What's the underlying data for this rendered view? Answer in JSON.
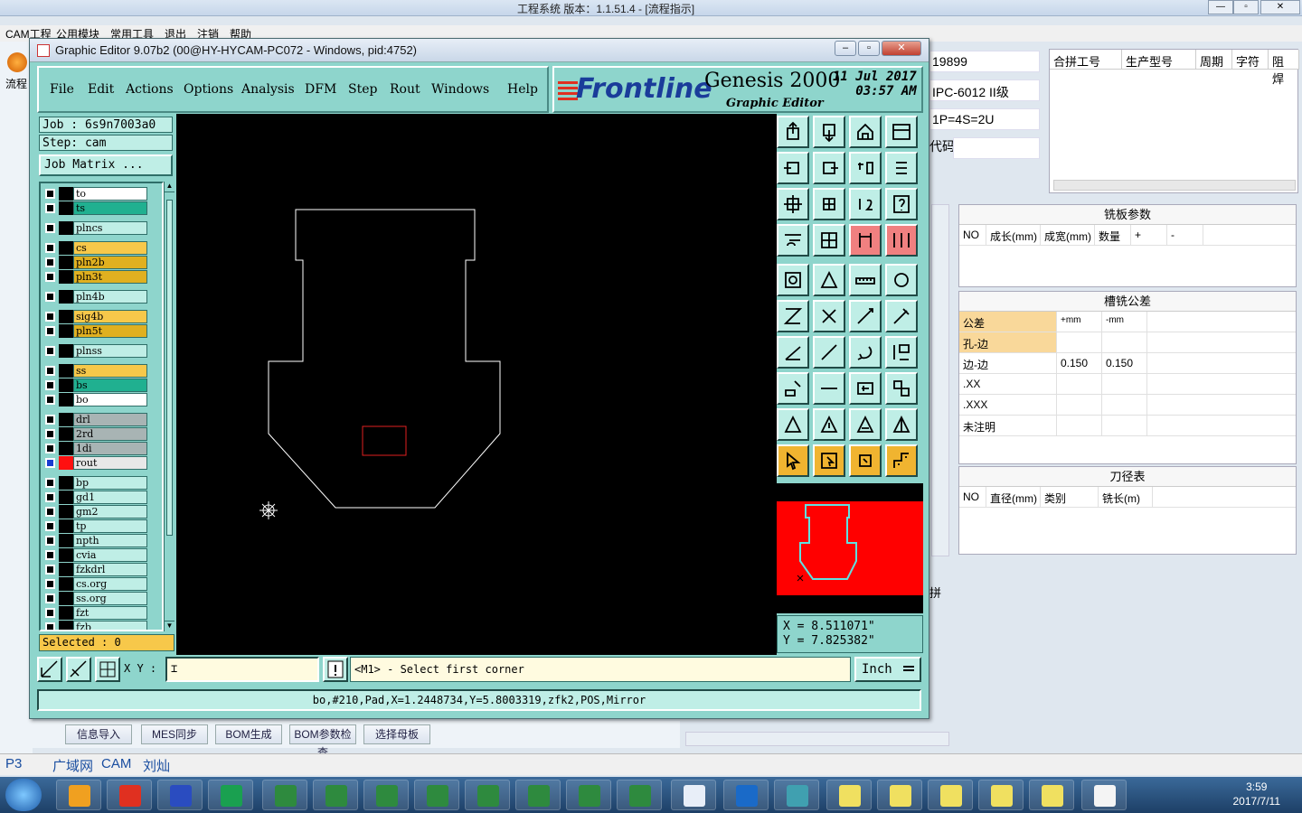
{
  "bg": {
    "title": "工程系统    版本：1.1.51.4 - [流程指示]",
    "menu": [
      "CAM工程",
      "公用模块",
      "常用工具",
      "退出",
      "注销",
      "帮助"
    ],
    "left_tab": "流程",
    "fields": [
      "19899",
      "IPC-6012 II级",
      "1P=4S=2U",
      "代码"
    ],
    "top_grid_headers": [
      "合拼工号",
      "生产型号",
      "周期",
      "字符",
      "阻焊"
    ],
    "panel1": {
      "title": "铣板参数",
      "headers": [
        "NO",
        "成长(mm)",
        "成宽(mm)",
        "数量",
        "+",
        "-"
      ]
    },
    "panel2": {
      "title": "槽铣公差",
      "headers": [
        "公差",
        "+mm",
        "-mm"
      ],
      "rows": [
        [
          "孔-边",
          "",
          ""
        ],
        [
          "边-边",
          "0.150",
          "0.150"
        ],
        [
          ".XX",
          "",
          ""
        ],
        [
          ".XXX",
          "",
          ""
        ],
        [
          "未注明",
          "",
          ""
        ]
      ]
    },
    "panel3": {
      "title": "刀径表",
      "headers": [
        "NO",
        "直径(mm)",
        "类别",
        "铣长(m)"
      ]
    },
    "side_label": "拼",
    "bottom_buttons": [
      "信息导入",
      "MES同步",
      "BOM生成",
      "BOM参数检查",
      "选择母板"
    ],
    "status": [
      "P3",
      "广域网",
      "CAM",
      "刘灿"
    ]
  },
  "taskbar": {
    "time": "3:59",
    "date": "2017/7/11"
  },
  "window": {
    "title": "Graphic Editor 9.07b2 (00@HY-HYCAM-PC072 - Windows, pid:4752)",
    "menu": [
      "File",
      "Edit",
      "Actions",
      "Options",
      "Analysis",
      "DFM",
      "Step",
      "Rout",
      "Windows",
      "Help"
    ],
    "logo": {
      "brand": "Frontline",
      "product": "Genesis 2000",
      "subtitle": "Graphic Editor",
      "date": "11  Jul  2017",
      "time": "03:57  AM"
    },
    "job": "Job  :  6s9n7003a0",
    "step": "Step:  cam",
    "job_matrix": "Job Matrix ...",
    "layers": [
      {
        "name": "to",
        "color": "#ffffff"
      },
      {
        "name": "ts",
        "color": "#20b090"
      },
      {
        "name": "plncs",
        "color": "#bfeee6"
      },
      {
        "name": "cs",
        "color": "#f7c84a"
      },
      {
        "name": "pln2b",
        "color": "#e0b020"
      },
      {
        "name": "pln3t",
        "color": "#e0b020"
      },
      {
        "name": "pln4b",
        "color": "#bfeee6"
      },
      {
        "name": "sig4b",
        "color": "#f7c84a"
      },
      {
        "name": "pln5t",
        "color": "#e0b020"
      },
      {
        "name": "plnss",
        "color": "#bfeee6"
      },
      {
        "name": "ss",
        "color": "#f7c84a"
      },
      {
        "name": "bs",
        "color": "#20b090"
      },
      {
        "name": "bo",
        "color": "#ffffff"
      },
      {
        "name": "drl",
        "color": "#a8b4b4"
      },
      {
        "name": "2rd",
        "color": "#a8b4b4"
      },
      {
        "name": "1di",
        "color": "#a8b4b4"
      },
      {
        "name": "rout",
        "color": "#e8e8e8"
      },
      {
        "name": "bp",
        "color": "#bfeee6"
      },
      {
        "name": "gd1",
        "color": "#bfeee6"
      },
      {
        "name": "gm2",
        "color": "#bfeee6"
      },
      {
        "name": "tp",
        "color": "#bfeee6"
      },
      {
        "name": "npth",
        "color": "#bfeee6"
      },
      {
        "name": "cvia",
        "color": "#bfeee6"
      },
      {
        "name": "fzkdrl",
        "color": "#bfeee6"
      },
      {
        "name": "cs.org",
        "color": "#bfeee6"
      },
      {
        "name": "ss.org",
        "color": "#bfeee6"
      },
      {
        "name": "fzt",
        "color": "#bfeee6"
      },
      {
        "name": "fzb",
        "color": "#bfeee6"
      }
    ],
    "selected": "Selected : 0",
    "coords": {
      "x": "X  =  8.511071\"",
      "y": "Y  =  7.825382\""
    },
    "xy_label": "X Y :",
    "prompt": "<M1> - Select first corner",
    "units": "Inch",
    "status_line": "bo,#210,Pad,X=1.2448734,Y=5.8003319,zfk2,POS,Mirror",
    "colors": {
      "board_outline": "#ffffff",
      "selection_box": "#e02020",
      "preview_bg": "#ff0000",
      "preview_outline": "#60e0e0"
    }
  }
}
